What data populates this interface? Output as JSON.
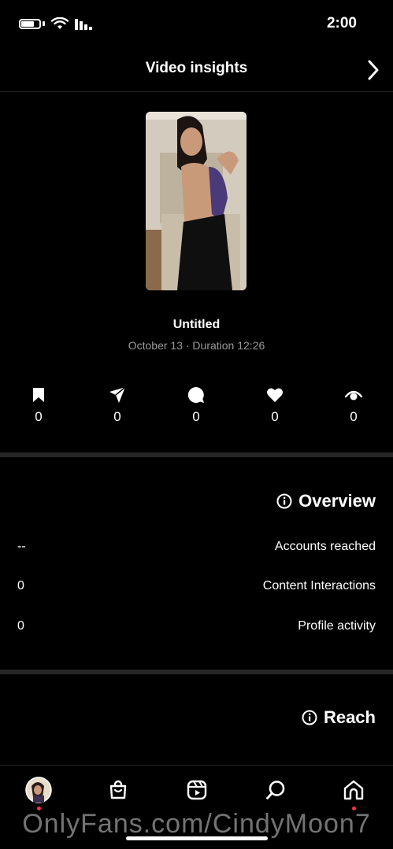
{
  "status_bar": {
    "time": "2:00"
  },
  "header": {
    "title": "Video insights"
  },
  "video": {
    "title": "Untitled",
    "meta": "October 13 · Duration 12:26"
  },
  "stats": [
    {
      "icon": "eye-icon",
      "value": "0"
    },
    {
      "icon": "heart-icon",
      "value": "0"
    },
    {
      "icon": "comment-icon",
      "value": "0"
    },
    {
      "icon": "send-icon",
      "value": "0"
    },
    {
      "icon": "bookmark-icon",
      "value": "0"
    }
  ],
  "overview": {
    "title": "Overview",
    "rows": [
      {
        "label": "Accounts reached",
        "value": "--"
      },
      {
        "label": "Content Interactions",
        "value": "0"
      },
      {
        "label": "Profile activity",
        "value": "0"
      }
    ]
  },
  "reach": {
    "title": "Reach"
  },
  "nav": [
    "home-icon",
    "search-icon",
    "reels-icon",
    "shop-icon",
    "profile-avatar"
  ],
  "watermark": "OnlyFans.com/CindyMoon7",
  "colors": {
    "background": "#000000",
    "notification_dot": "#ff3040",
    "meta_text": "#9a9a9a"
  }
}
